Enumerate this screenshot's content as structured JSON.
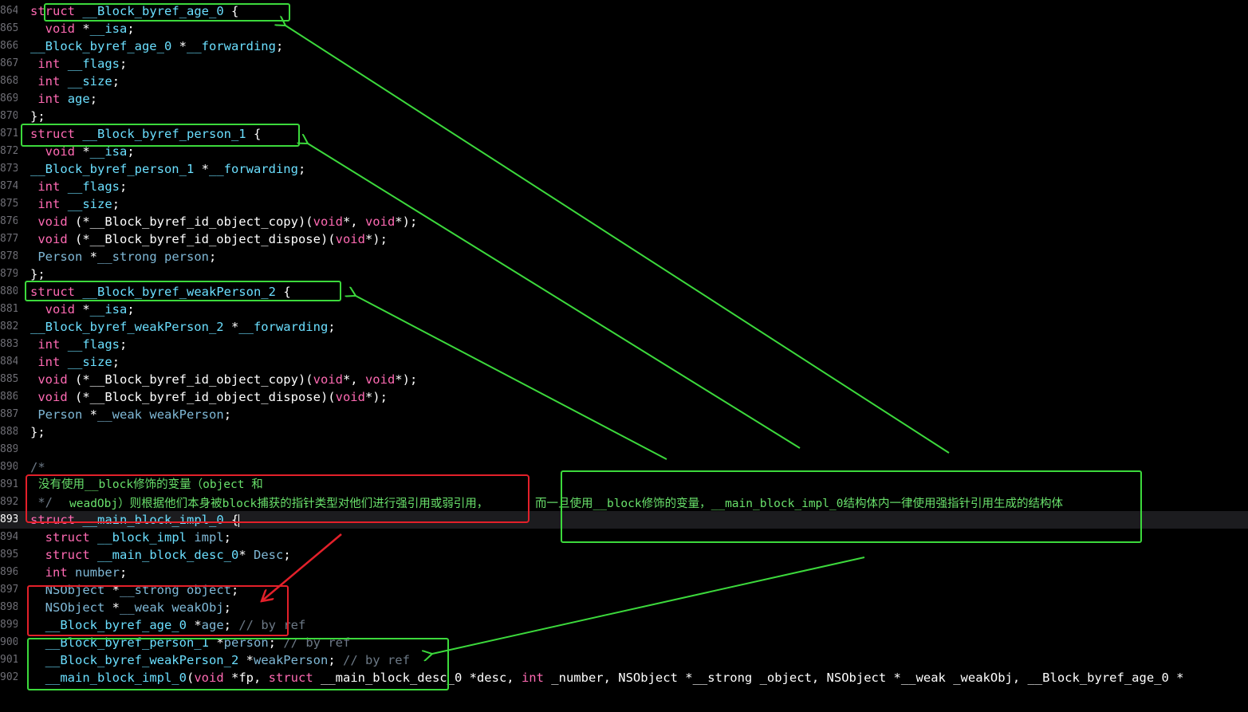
{
  "editor": {
    "current_line": "893",
    "lines": [
      {
        "num": "864",
        "tokens": [
          [
            "kw",
            "struct"
          ],
          [
            "pu",
            " "
          ],
          [
            "ty",
            "__Block_byref_age_0"
          ],
          [
            "pu",
            " {"
          ]
        ]
      },
      {
        "num": "865",
        "tokens": [
          [
            "pu",
            "  "
          ],
          [
            "kw",
            "void"
          ],
          [
            "pu",
            " *"
          ],
          [
            "ty",
            "__isa"
          ],
          [
            "pu",
            ";"
          ]
        ]
      },
      {
        "num": "866",
        "tokens": [
          [
            "ty",
            "__Block_byref_age_0"
          ],
          [
            "pu",
            " *"
          ],
          [
            "ty",
            "__forwarding"
          ],
          [
            "pu",
            ";"
          ]
        ]
      },
      {
        "num": "867",
        "tokens": [
          [
            "pu",
            " "
          ],
          [
            "kw",
            "int"
          ],
          [
            "pu",
            " "
          ],
          [
            "ty",
            "__flags"
          ],
          [
            "pu",
            ";"
          ]
        ]
      },
      {
        "num": "868",
        "tokens": [
          [
            "pu",
            " "
          ],
          [
            "kw",
            "int"
          ],
          [
            "pu",
            " "
          ],
          [
            "ty",
            "__size"
          ],
          [
            "pu",
            ";"
          ]
        ]
      },
      {
        "num": "869",
        "tokens": [
          [
            "pu",
            " "
          ],
          [
            "kw",
            "int"
          ],
          [
            "pu",
            " "
          ],
          [
            "ty",
            "age"
          ],
          [
            "pu",
            ";"
          ]
        ]
      },
      {
        "num": "870",
        "tokens": [
          [
            "pu",
            "};"
          ]
        ]
      },
      {
        "num": "871",
        "tokens": [
          [
            "kw",
            "struct"
          ],
          [
            "pu",
            " "
          ],
          [
            "ty",
            "__Block_byref_person_1"
          ],
          [
            "pu",
            " {"
          ]
        ]
      },
      {
        "num": "872",
        "tokens": [
          [
            "pu",
            "  "
          ],
          [
            "kw",
            "void"
          ],
          [
            "pu",
            " *"
          ],
          [
            "ty",
            "__isa"
          ],
          [
            "pu",
            ";"
          ]
        ]
      },
      {
        "num": "873",
        "tokens": [
          [
            "ty",
            "__Block_byref_person_1"
          ],
          [
            "pu",
            " *"
          ],
          [
            "ty",
            "__forwarding"
          ],
          [
            "pu",
            ";"
          ]
        ]
      },
      {
        "num": "874",
        "tokens": [
          [
            "pu",
            " "
          ],
          [
            "kw",
            "int"
          ],
          [
            "pu",
            " "
          ],
          [
            "ty",
            "__flags"
          ],
          [
            "pu",
            ";"
          ]
        ]
      },
      {
        "num": "875",
        "tokens": [
          [
            "pu",
            " "
          ],
          [
            "kw",
            "int"
          ],
          [
            "pu",
            " "
          ],
          [
            "ty",
            "__size"
          ],
          [
            "pu",
            ";"
          ]
        ]
      },
      {
        "num": "876",
        "tokens": [
          [
            "pu",
            " "
          ],
          [
            "kw",
            "void"
          ],
          [
            "pu",
            " (*__Block_byref_id_object_copy)("
          ],
          [
            "kw",
            "void"
          ],
          [
            "pu",
            "*, "
          ],
          [
            "kw",
            "void"
          ],
          [
            "pu",
            "*);"
          ]
        ]
      },
      {
        "num": "877",
        "tokens": [
          [
            "pu",
            " "
          ],
          [
            "kw",
            "void"
          ],
          [
            "pu",
            " (*__Block_byref_id_object_dispose)("
          ],
          [
            "kw",
            "void"
          ],
          [
            "pu",
            "*);"
          ]
        ]
      },
      {
        "num": "878",
        "tokens": [
          [
            "pu",
            " "
          ],
          [
            "cls",
            "Person"
          ],
          [
            "pu",
            " *"
          ],
          [
            "cls",
            "__strong"
          ],
          [
            "pu",
            " "
          ],
          [
            "cls",
            "person"
          ],
          [
            "pu",
            ";"
          ]
        ]
      },
      {
        "num": "879",
        "tokens": [
          [
            "pu",
            "};"
          ]
        ]
      },
      {
        "num": "880",
        "tokens": [
          [
            "kw",
            "struct"
          ],
          [
            "pu",
            " "
          ],
          [
            "ty",
            "__Block_byref_weakPerson_2"
          ],
          [
            "pu",
            " {"
          ]
        ]
      },
      {
        "num": "881",
        "tokens": [
          [
            "pu",
            "  "
          ],
          [
            "kw",
            "void"
          ],
          [
            "pu",
            " *"
          ],
          [
            "ty",
            "__isa"
          ],
          [
            "pu",
            ";"
          ]
        ]
      },
      {
        "num": "882",
        "tokens": [
          [
            "ty",
            "__Block_byref_weakPerson_2"
          ],
          [
            "pu",
            " *"
          ],
          [
            "ty",
            "__forwarding"
          ],
          [
            "pu",
            ";"
          ]
        ]
      },
      {
        "num": "883",
        "tokens": [
          [
            "pu",
            " "
          ],
          [
            "kw",
            "int"
          ],
          [
            "pu",
            " "
          ],
          [
            "ty",
            "__flags"
          ],
          [
            "pu",
            ";"
          ]
        ]
      },
      {
        "num": "884",
        "tokens": [
          [
            "pu",
            " "
          ],
          [
            "kw",
            "int"
          ],
          [
            "pu",
            " "
          ],
          [
            "ty",
            "__size"
          ],
          [
            "pu",
            ";"
          ]
        ]
      },
      {
        "num": "885",
        "tokens": [
          [
            "pu",
            " "
          ],
          [
            "kw",
            "void"
          ],
          [
            "pu",
            " (*__Block_byref_id_object_copy)("
          ],
          [
            "kw",
            "void"
          ],
          [
            "pu",
            "*, "
          ],
          [
            "kw",
            "void"
          ],
          [
            "pu",
            "*);"
          ]
        ]
      },
      {
        "num": "886",
        "tokens": [
          [
            "pu",
            " "
          ],
          [
            "kw",
            "void"
          ],
          [
            "pu",
            " (*__Block_byref_id_object_dispose)("
          ],
          [
            "kw",
            "void"
          ],
          [
            "pu",
            "*);"
          ]
        ]
      },
      {
        "num": "887",
        "tokens": [
          [
            "pu",
            " "
          ],
          [
            "cls",
            "Person"
          ],
          [
            "pu",
            " *"
          ],
          [
            "cls",
            "__weak"
          ],
          [
            "pu",
            " "
          ],
          [
            "cls",
            "weakPerson"
          ],
          [
            "pu",
            ";"
          ]
        ]
      },
      {
        "num": "888",
        "tokens": [
          [
            "pu",
            "};"
          ]
        ]
      },
      {
        "num": "889",
        "tokens": []
      },
      {
        "num": "890",
        "tokens": [
          [
            "cm",
            "/*"
          ]
        ]
      },
      {
        "num": "891",
        "tokens": []
      },
      {
        "num": "892",
        "tokens": [
          [
            "cm",
            " */"
          ]
        ]
      },
      {
        "num": "893",
        "tokens": [
          [
            "kw",
            "struct"
          ],
          [
            "pu",
            " "
          ],
          [
            "ty",
            "__main_block_impl_0"
          ],
          [
            "pu",
            " {"
          ],
          [
            "caret",
            ""
          ]
        ]
      },
      {
        "num": "894",
        "tokens": [
          [
            "pu",
            "  "
          ],
          [
            "kw",
            "struct"
          ],
          [
            "pu",
            " "
          ],
          [
            "ty",
            "__block_impl"
          ],
          [
            "pu",
            " "
          ],
          [
            "cls",
            "impl"
          ],
          [
            "pu",
            ";"
          ]
        ]
      },
      {
        "num": "895",
        "tokens": [
          [
            "pu",
            "  "
          ],
          [
            "kw",
            "struct"
          ],
          [
            "pu",
            " "
          ],
          [
            "ty",
            "__main_block_desc_0"
          ],
          [
            "pu",
            "* "
          ],
          [
            "cls",
            "Desc"
          ],
          [
            "pu",
            ";"
          ]
        ]
      },
      {
        "num": "896",
        "tokens": [
          [
            "pu",
            "  "
          ],
          [
            "kw",
            "int"
          ],
          [
            "pu",
            " "
          ],
          [
            "cls",
            "number"
          ],
          [
            "pu",
            ";"
          ]
        ]
      },
      {
        "num": "897",
        "tokens": [
          [
            "pu",
            "  "
          ],
          [
            "cls",
            "NSObject"
          ],
          [
            "pu",
            " *"
          ],
          [
            "cls",
            "__strong"
          ],
          [
            "pu",
            " "
          ],
          [
            "cls",
            "object"
          ],
          [
            "pu",
            ";"
          ]
        ]
      },
      {
        "num": "898",
        "tokens": [
          [
            "pu",
            "  "
          ],
          [
            "cls",
            "NSObject"
          ],
          [
            "pu",
            " *"
          ],
          [
            "cls",
            "__weak"
          ],
          [
            "pu",
            " "
          ],
          [
            "cls",
            "weakObj"
          ],
          [
            "pu",
            ";"
          ]
        ]
      },
      {
        "num": "899",
        "tokens": [
          [
            "pu",
            "  "
          ],
          [
            "ty",
            "__Block_byref_age_0"
          ],
          [
            "pu",
            " *"
          ],
          [
            "cls",
            "age"
          ],
          [
            "pu",
            "; "
          ],
          [
            "cm",
            "// by ref"
          ]
        ]
      },
      {
        "num": "900",
        "tokens": [
          [
            "pu",
            "  "
          ],
          [
            "ty",
            "__Block_byref_person_1"
          ],
          [
            "pu",
            " *"
          ],
          [
            "cls",
            "person"
          ],
          [
            "pu",
            "; "
          ],
          [
            "cm",
            "// by ref"
          ]
        ]
      },
      {
        "num": "901",
        "tokens": [
          [
            "pu",
            "  "
          ],
          [
            "ty",
            "__Block_byref_weakPerson_2"
          ],
          [
            "pu",
            " *"
          ],
          [
            "cls",
            "weakPerson"
          ],
          [
            "pu",
            "; "
          ],
          [
            "cm",
            "// by ref"
          ]
        ]
      },
      {
        "num": "902",
        "tokens": [
          [
            "pu",
            "  "
          ],
          [
            "ty",
            "__main_block_impl_0"
          ],
          [
            "pu",
            "("
          ],
          [
            "kw",
            "void"
          ],
          [
            "pu",
            " *fp, "
          ],
          [
            "kw",
            "struct"
          ],
          [
            "pu",
            " __main_block_desc_0 *desc, "
          ],
          [
            "kw",
            "int"
          ],
          [
            "pu",
            " _number, NSObject *__strong _object, NSObject *__weak _weakObj, __Block_byref_age_0 *"
          ]
        ]
      }
    ]
  },
  "annotations": {
    "comment_note_line1": "没有使用__block修饰的变量（object 和",
    "comment_note_line2": "weadObj）则根据他们本身被block捕获的指针类型对他们进行强引用或弱引用，",
    "green_note": "而一旦使用__block修饰的变量，__main_block_impl_0结构体内一律使用强指针引用生成的结构体",
    "colors": {
      "green": "#3cd93c",
      "red": "#e3202a",
      "keyword": "#ff6ab3",
      "type": "#6bdfff",
      "background": "#000000"
    }
  }
}
